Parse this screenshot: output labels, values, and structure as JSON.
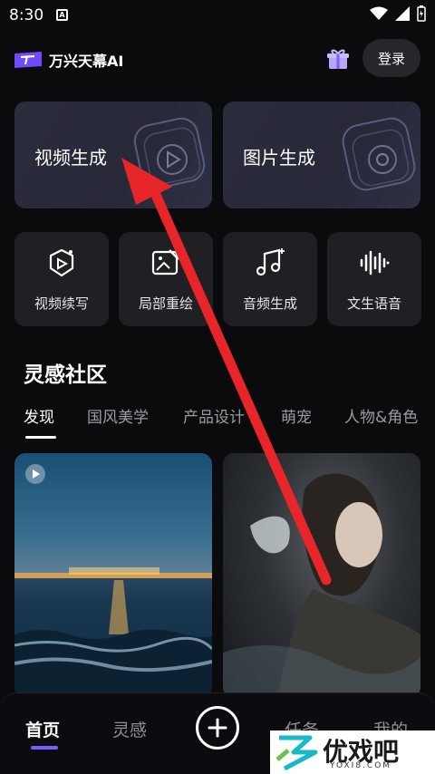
{
  "status_bar": {
    "time": "8:30"
  },
  "header": {
    "app_name": "万兴天幕AI",
    "login_label": "登录"
  },
  "main_cards": [
    {
      "label": "视频生成"
    },
    {
      "label": "图片生成"
    }
  ],
  "tools": [
    {
      "label": "视频续写"
    },
    {
      "label": "局部重绘"
    },
    {
      "label": "音频生成"
    },
    {
      "label": "文生语音"
    }
  ],
  "community": {
    "title": "灵感社区",
    "tabs": [
      "发现",
      "国风美学",
      "产品设计",
      "萌宠",
      "人物&角色"
    ]
  },
  "bottom_nav": {
    "items": [
      "首页",
      "灵感",
      "任务",
      "我的"
    ]
  },
  "watermark": {
    "brand": "优戏吧",
    "url": "YOXI8.COM"
  },
  "colors": {
    "accent": "#7a5cff",
    "annotation_arrow": "#e8262a"
  }
}
